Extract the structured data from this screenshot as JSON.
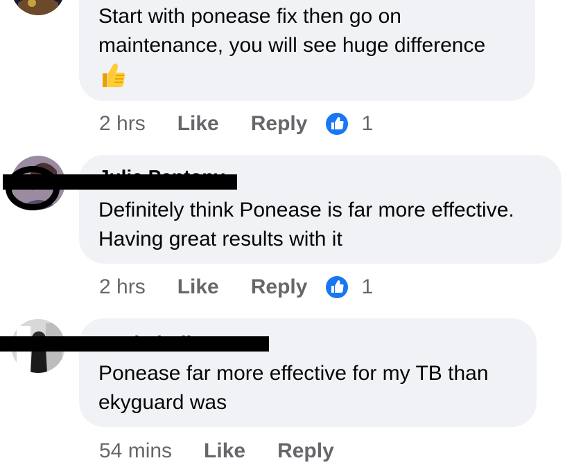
{
  "comments": [
    {
      "author": "",
      "lines": [
        "Start with ponease fix then go on",
        "maintenance,  you will see huge difference"
      ],
      "emoji": "thumbs-up",
      "time": "2 hrs",
      "like": "Like",
      "reply": "Reply",
      "reaction": "like",
      "reaction_count": "1"
    },
    {
      "author": "Julie Pentony",
      "lines": [
        "Definitely think Ponease is far more effective.",
        "Having great results with it"
      ],
      "time": "2 hrs",
      "like": "Like",
      "reply": "Reply",
      "reaction": "like",
      "reaction_count": "1"
    },
    {
      "author": "Rachel Allen",
      "lines": [
        "Ponease far more effective for my TB than",
        "ekyguard was"
      ],
      "time": "54 mins",
      "like": "Like",
      "reply": "Reply"
    }
  ],
  "colors": {
    "bubble": "#f0f2f5",
    "meta_text": "#65676b",
    "like_blue": "#1877f2",
    "redaction": "#000000"
  }
}
